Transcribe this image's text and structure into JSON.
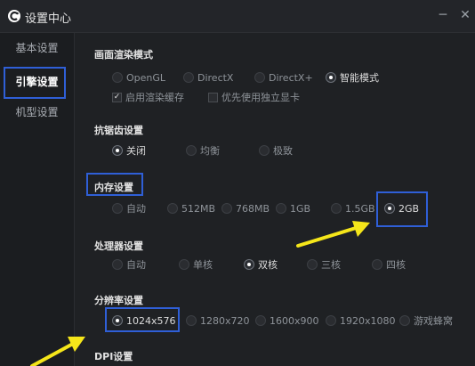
{
  "window": {
    "title": "设置中心",
    "min_glyph": "─",
    "close_glyph": "✕"
  },
  "sidebar": {
    "items": [
      {
        "label": "基本设置",
        "active": false
      },
      {
        "label": "引擎设置",
        "active": true
      },
      {
        "label": "机型设置",
        "active": false
      }
    ]
  },
  "render_mode": {
    "title": "画面渲染模式",
    "options": [
      "OpenGL",
      "DirectX",
      "DirectX+",
      "智能模式"
    ],
    "selected": "智能模式",
    "cache_label": "启用渲染缓存",
    "cache_checked": true,
    "gpu_label": "优先使用独立显卡",
    "gpu_checked": false
  },
  "antialias": {
    "title": "抗锯齿设置",
    "options": [
      "关闭",
      "均衡",
      "极致"
    ],
    "selected": "关闭"
  },
  "memory": {
    "title": "内存设置",
    "options": [
      "自动",
      "512MB",
      "768MB",
      "1GB",
      "1.5GB",
      "2GB"
    ],
    "selected": "2GB"
  },
  "cpu": {
    "title": "处理器设置",
    "options": [
      "自动",
      "单核",
      "双核",
      "三核",
      "四核"
    ],
    "selected": "双核"
  },
  "resolution": {
    "title": "分辨率设置",
    "options": [
      "1024x576",
      "1280x720",
      "1600x900",
      "1920x1080",
      "游戏蜂窝"
    ],
    "selected": "1024x576"
  },
  "dpi": {
    "title": "DPI设置"
  },
  "colors": {
    "highlight": "#2f5fd7",
    "arrow": "#f5e61a"
  },
  "icons": {
    "check": "✓"
  }
}
